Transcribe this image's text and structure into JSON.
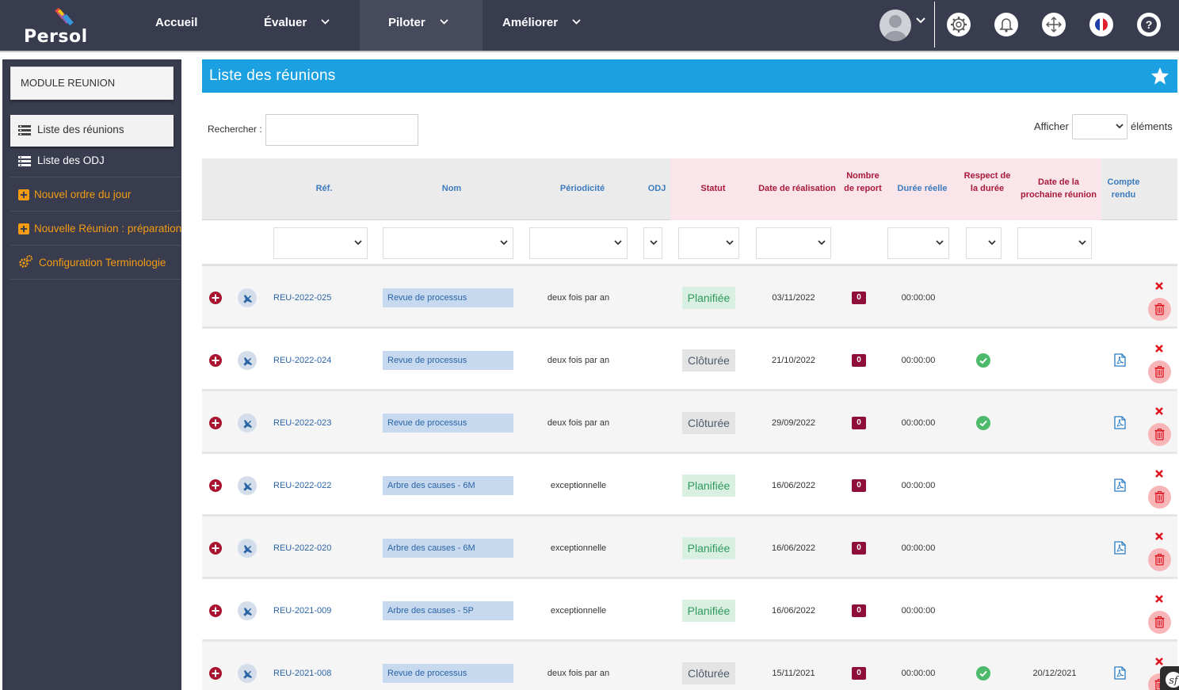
{
  "app": {
    "logo_text": "Persol"
  },
  "nav": {
    "items": [
      {
        "label": "Accueil",
        "has_dropdown": false
      },
      {
        "label": "Évaluer",
        "has_dropdown": true
      },
      {
        "label": "Piloter",
        "has_dropdown": true,
        "active": true
      },
      {
        "label": "Améliorer",
        "has_dropdown": true
      }
    ],
    "icons": [
      "user-avatar",
      "settings-icon",
      "bell-icon",
      "move-icon",
      "language-flag-icon",
      "help-icon"
    ]
  },
  "sidebar": {
    "module_title": "MODULE REUNION",
    "items": [
      {
        "label": "Liste des réunions",
        "icon": "list-icon",
        "active": true
      },
      {
        "label": "Liste des ODJ",
        "icon": "list-icon"
      },
      {
        "label": "Nouvel ordre du jour",
        "icon": "plus-square-icon",
        "accent": true
      },
      {
        "label": "Nouvelle Réunion : préparation",
        "icon": "plus-square-icon",
        "accent": true
      },
      {
        "label": "Configuration Terminologie",
        "icon": "gears-icon",
        "accent": true
      }
    ]
  },
  "page": {
    "title": "Liste des réunions",
    "search_label": "Rechercher :",
    "search_value": "",
    "show_label": "Afficher",
    "show_value": "",
    "show_suffix": "éléments"
  },
  "table": {
    "columns": [
      {
        "key": "ref",
        "label": "Réf."
      },
      {
        "key": "nom",
        "label": "Nom"
      },
      {
        "key": "periodicite",
        "label": "Périodicité"
      },
      {
        "key": "odj",
        "label": "ODJ"
      },
      {
        "key": "statut",
        "label": "Statut"
      },
      {
        "key": "date_realisation",
        "label": "Date de réalisation"
      },
      {
        "key": "nombre_report",
        "label": "Nombre de report"
      },
      {
        "key": "duree_reelle",
        "label": "Durée réelle"
      },
      {
        "key": "respect_duree",
        "label": "Respect de la durée"
      },
      {
        "key": "date_prochaine",
        "label": "Date de la prochaine réunion"
      },
      {
        "key": "compte_rendu",
        "label": "Compte rendu"
      }
    ],
    "rows": [
      {
        "ref": "REU-2022-025",
        "nom": "Revue de processus",
        "periodicite": "deux fois par an",
        "statut": "Planifiée",
        "statut_type": "plan",
        "date": "03/11/2022",
        "report": "0",
        "duree": "00:00:00",
        "respect": false,
        "prochaine": "",
        "pdf": false
      },
      {
        "ref": "REU-2022-024",
        "nom": "Revue de processus",
        "periodicite": "deux fois par an",
        "statut": "Clôturée",
        "statut_type": "clos",
        "date": "21/10/2022",
        "report": "0",
        "duree": "00:00:00",
        "respect": true,
        "prochaine": "",
        "pdf": true
      },
      {
        "ref": "REU-2022-023",
        "nom": "Revue de processus",
        "periodicite": "deux fois par an",
        "statut": "Clôturée",
        "statut_type": "clos",
        "date": "29/09/2022",
        "report": "0",
        "duree": "00:00:00",
        "respect": true,
        "prochaine": "",
        "pdf": true
      },
      {
        "ref": "REU-2022-022",
        "nom": "Arbre des causes - 6M",
        "periodicite": "exceptionnelle",
        "statut": "Planifiée",
        "statut_type": "plan",
        "date": "16/06/2022",
        "report": "0",
        "duree": "00:00:00",
        "respect": false,
        "prochaine": "",
        "pdf": true
      },
      {
        "ref": "REU-2022-020",
        "nom": "Arbre des causes - 6M",
        "periodicite": "exceptionnelle",
        "statut": "Planifiée",
        "statut_type": "plan",
        "date": "16/06/2022",
        "report": "0",
        "duree": "00:00:00",
        "respect": false,
        "prochaine": "",
        "pdf": true
      },
      {
        "ref": "REU-2021-009",
        "nom": "Arbre des causes - 5P",
        "periodicite": "exceptionnelle",
        "statut": "Planifiée",
        "statut_type": "plan",
        "date": "16/06/2022",
        "report": "0",
        "duree": "00:00:00",
        "respect": false,
        "prochaine": "",
        "pdf": false
      },
      {
        "ref": "REU-2021-008",
        "nom": "Revue de processus",
        "periodicite": "deux fois par an",
        "statut": "Clôturée",
        "statut_type": "clos",
        "date": "15/11/2021",
        "report": "0",
        "duree": "00:00:00",
        "respect": true,
        "prochaine": "20/12/2021",
        "pdf": true
      }
    ]
  },
  "colors": {
    "topbar": "#383c4e",
    "header_blue": "#1ba1e2",
    "accent_orange": "#f39c12",
    "badge": "#8e0f3b",
    "planned": "#2e9a5b",
    "closed": "#4d5b6b"
  }
}
